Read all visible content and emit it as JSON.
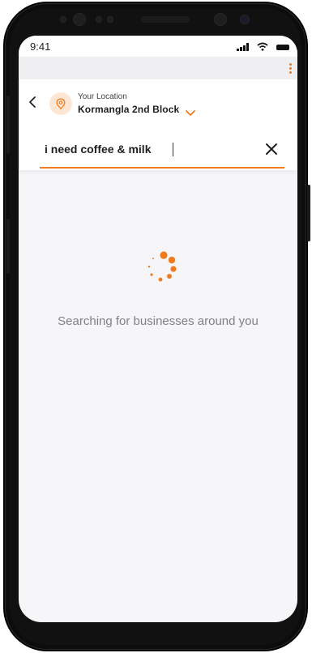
{
  "status_bar": {
    "time": "9:41"
  },
  "header": {
    "location_label": "Your Location",
    "location_name": "Kormangla 2nd Block"
  },
  "search": {
    "value": "i need coffee & milk"
  },
  "loading": {
    "message": "Searching for businesses around you"
  },
  "colors": {
    "accent": "#f07a1e",
    "accent_light": "#fde7d4",
    "background": "#f6f6f8",
    "muted_text": "#808087"
  },
  "icons": {
    "back": "back-arrow-icon",
    "location_pin": "location-pin-icon",
    "location_dropdown": "chevron-down-icon",
    "clear": "close-icon",
    "overflow": "more-vertical-icon",
    "loading": "spinner-icon"
  }
}
